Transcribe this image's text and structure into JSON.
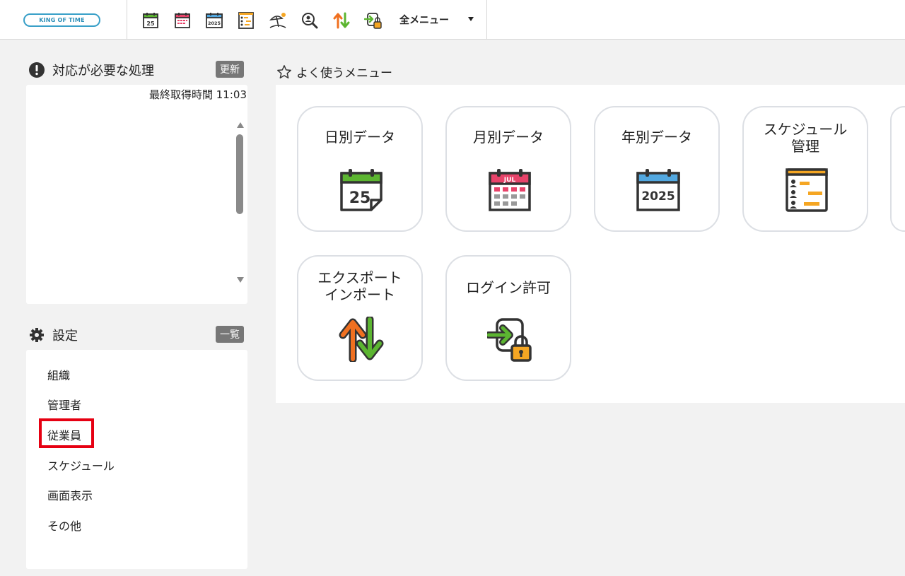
{
  "header": {
    "logo_text": "KING OF TIME",
    "all_menu_label": "全メニュー"
  },
  "toolbar_icons": [
    "daily-calendar-icon",
    "monthly-calendar-icon",
    "yearly-calendar-icon",
    "schedule-icon",
    "vacation-icon",
    "search-person-icon",
    "export-import-icon",
    "login-permission-icon"
  ],
  "pending": {
    "title": "対応が必要な処理",
    "refresh_label": "更新",
    "last_fetch": "最終取得時間 11:03"
  },
  "settings": {
    "title": "設定",
    "list_label": "一覧",
    "items": [
      "組織",
      "管理者",
      "従業員",
      "スケジュール",
      "画面表示",
      "その他"
    ],
    "highlighted_item": "従業員"
  },
  "favorites": {
    "title": "よく使うメニュー",
    "tiles": [
      {
        "label": "日別データ",
        "icon": "daily-calendar-icon",
        "day": "25"
      },
      {
        "label": "月別データ",
        "icon": "monthly-calendar-icon",
        "month": "JUL"
      },
      {
        "label": "年別データ",
        "icon": "yearly-calendar-icon",
        "year": "2025"
      },
      {
        "label": "スケジュール\n管理",
        "icon": "schedule-icon"
      },
      {
        "label": "エクスポート\nインポート",
        "icon": "export-import-icon"
      },
      {
        "label": "ログイン許可",
        "icon": "login-permission-icon"
      }
    ]
  },
  "colors": {
    "green": "#5cb531",
    "pink": "#e8436a",
    "blue": "#52a8e0",
    "orange": "#f5a623",
    "dark": "#333333",
    "highlight": "#e60012"
  }
}
